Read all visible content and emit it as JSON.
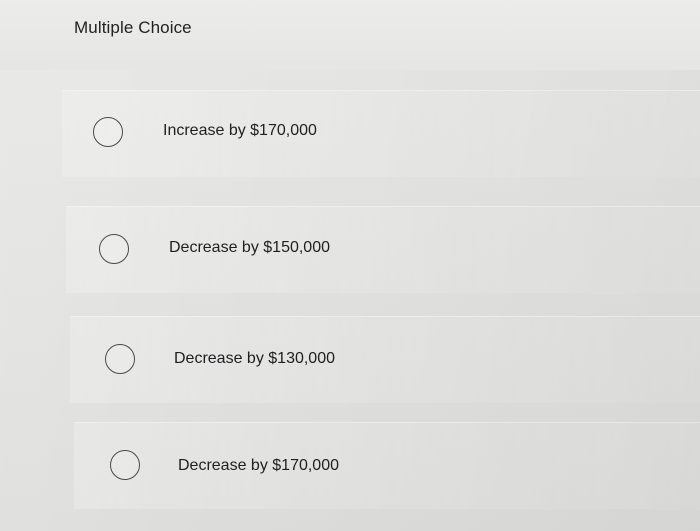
{
  "question": {
    "heading": "Multiple Choice"
  },
  "options": [
    {
      "label": "Increase by $170,000",
      "selected": false
    },
    {
      "label": "Decrease by $150,000",
      "selected": false
    },
    {
      "label": "Decrease by $130,000",
      "selected": false
    },
    {
      "label": "Decrease by $170,000",
      "selected": false
    }
  ]
}
